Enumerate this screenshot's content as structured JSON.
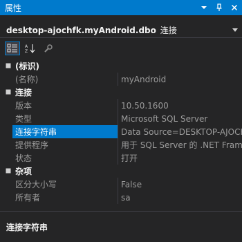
{
  "window": {
    "title": "属性",
    "btn_dropdown": "▾",
    "btn_pin": "📌",
    "btn_close": "✕"
  },
  "object": {
    "name": "desktop-ajochfk.myAndroid.dbo",
    "type": "连接"
  },
  "toolbar": {
    "categorized_icon": "categorized-icon",
    "alphabetical_icon": "alphabetical-icon",
    "property_pages_icon": "wrench-icon"
  },
  "grid": {
    "categories": [
      {
        "label": "(标识)",
        "toggle": "■",
        "properties": [
          {
            "name": "(名称)",
            "value": "myAndroid"
          }
        ]
      },
      {
        "label": "连接",
        "toggle": "■",
        "properties": [
          {
            "name": "版本",
            "value": "10.50.1600"
          },
          {
            "name": "类型",
            "value": "Microsoft SQL Server"
          },
          {
            "name": "连接字符串",
            "value": "Data Source=DESKTOP-AJOCHFK;Initial Catalog=myAndroid"
          },
          {
            "name": "提供程序",
            "value": "用于 SQL Server 的 .NET Framework 数据提供程序"
          },
          {
            "name": "状态",
            "value": "打开"
          }
        ]
      },
      {
        "label": "杂项",
        "toggle": "■",
        "properties": [
          {
            "name": "区分大小写",
            "value": "False"
          },
          {
            "name": "所有者",
            "value": "sa"
          }
        ]
      }
    ]
  },
  "description": {
    "title": "连接字符串"
  },
  "colors": {
    "accent": "#007acc",
    "background": "#252526",
    "text": "#f1f1f1",
    "muted_text": "#9b9b9b"
  }
}
